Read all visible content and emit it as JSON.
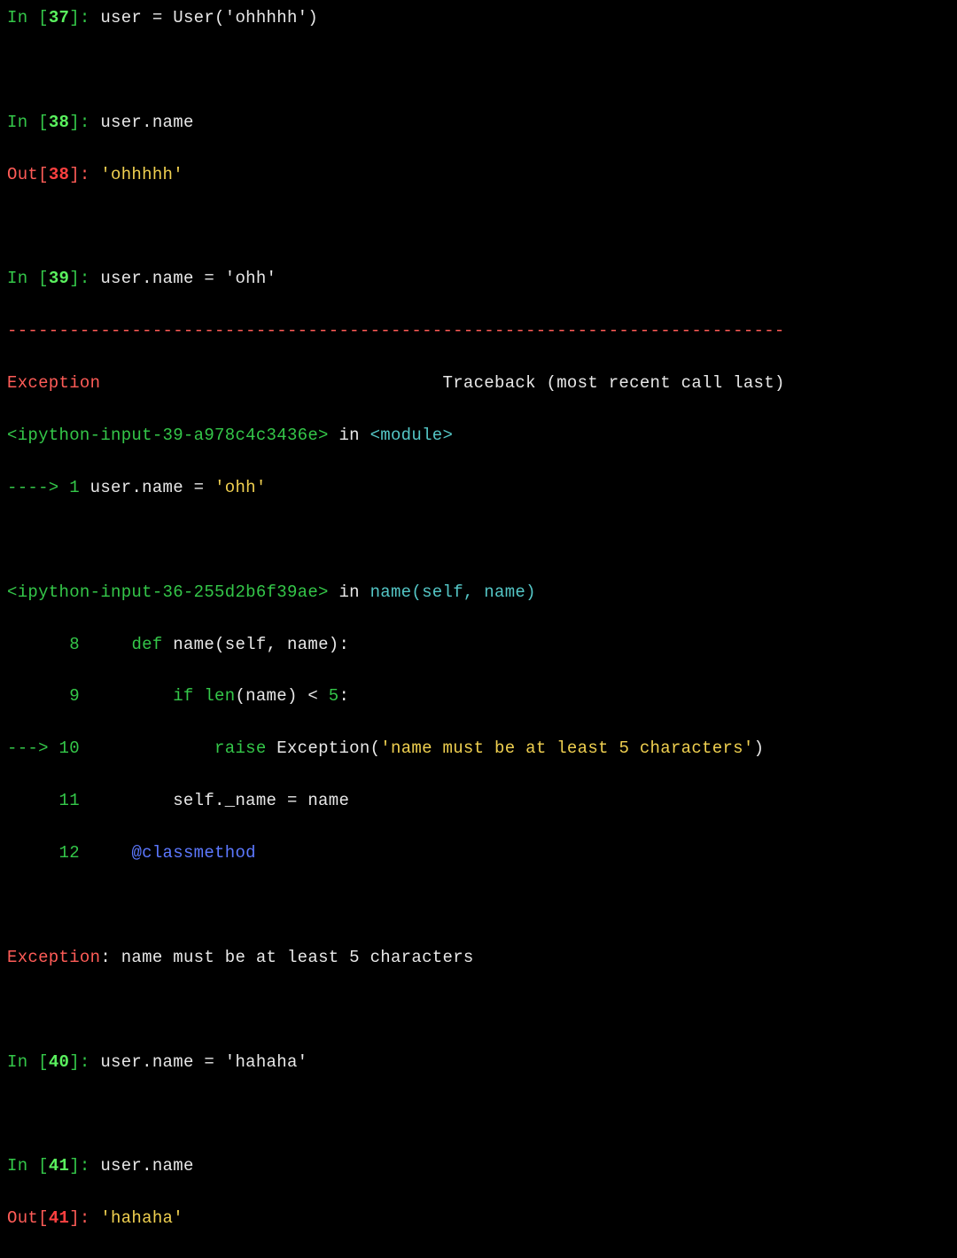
{
  "cells": {
    "c37": {
      "num": "37",
      "code": "user = User('ohhhhh')"
    },
    "c38": {
      "num": "38",
      "in_code": "user.name",
      "out_val": "'ohhhhh'"
    },
    "c39": {
      "num": "39",
      "in_code": "user.name = 'ohh'"
    },
    "c40": {
      "num": "40",
      "in_code": "user.name = 'hahaha'"
    },
    "c41": {
      "num": "41",
      "in_code": "user.name",
      "out_val": "'hahaha'"
    }
  },
  "tb": {
    "dash": "---------------------------------------------------------------------------",
    "exc_name": "Exception",
    "hdr_right": "Traceback (most recent call last)",
    "file1": "<ipython-input-39-a978c4c3436e>",
    "in_kw": " in ",
    "mod": "<module>",
    "arrow": "----> 1 ",
    "arrow_code_l": "user",
    "arrow_code_r": ".name = ",
    "arrow_code_str": "'ohh'",
    "file2": "<ipython-input-36-255d2b6f39ae>",
    "func_call": "name(self, name)",
    "lines": {
      "l8": {
        "num": "      8     ",
        "def": "def ",
        "fn": "name",
        "args": "(self, name):"
      },
      "l9": {
        "num": "      9         ",
        "if": "if ",
        "len": "len",
        "rest1": "(name) < ",
        "five": "5",
        "colon": ":"
      },
      "l10": {
        "num": "---> 10             ",
        "raise": "raise ",
        "exc": "Exception",
        "open": "(",
        "str": "'name must be at least 5 characters'",
        "close": ")"
      },
      "l11": {
        "num": "     11         ",
        "selfp": "self._name = name"
      },
      "l12": {
        "num": "     12     ",
        "dec": "@classmethod"
      }
    },
    "final_msg": ": name must be at least 5 characters"
  },
  "labels": {
    "in_open": "In [",
    "out_open": "Out[",
    "close": "]: "
  }
}
